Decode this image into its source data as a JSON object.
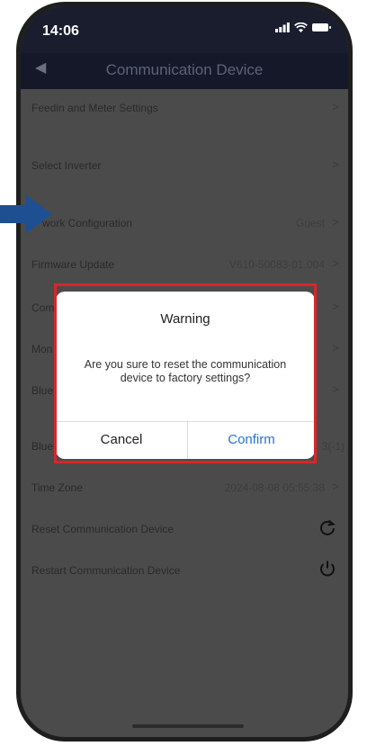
{
  "status_bar": {
    "time": "14:06"
  },
  "nav": {
    "back_icon": "chevron-left-icon",
    "title": "Communication Device"
  },
  "list": {
    "feedin": {
      "label": "Feedin and Meter Settings"
    },
    "select_inverter": {
      "label": "Select Inverter"
    },
    "network": {
      "label": "work Configuration",
      "value": "Guest"
    },
    "firmware": {
      "label": "Firmware Update",
      "value": "V610-50083-01.004"
    },
    "comm": {
      "label": "Com"
    },
    "monitor": {
      "label": "Mon"
    },
    "bluetooth1": {
      "label": "Blue"
    },
    "bluetooth2": {
      "label": "Blue",
      "value": "3(-1)"
    },
    "timezone": {
      "label": "Time Zone",
      "value": "2024-08-08 05:55:38"
    },
    "reset": {
      "label": "Reset Communication Device",
      "icon": "reset-icon"
    },
    "restart": {
      "label": "Restart Communication Device",
      "icon": "power-icon"
    }
  },
  "dialog": {
    "title": "Warning",
    "message": "Are you sure to reset the communication device to factory settings?",
    "cancel_label": "Cancel",
    "confirm_label": "Confirm"
  },
  "colors": {
    "highlight": "#d9252c",
    "confirm": "#2673d8",
    "pointer_arrow": "#1f4f93"
  }
}
